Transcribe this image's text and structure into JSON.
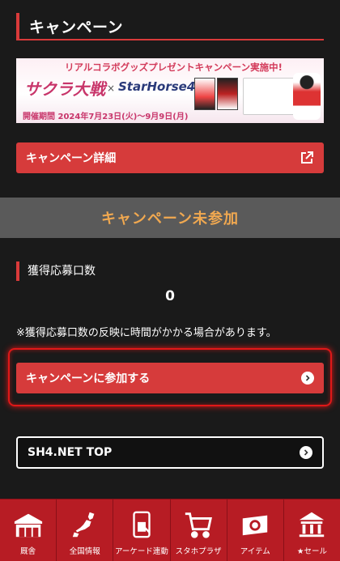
{
  "campaign": {
    "section_title": "キャンペーン",
    "banner": {
      "headline": "リアルコラボグッズプレゼントキャンペーン実施中!",
      "logo_left": "サクラ大戦",
      "times": "×",
      "logo_right": "StarHorse4",
      "period": "開催期間 2024年7月23日(火)〜9月9日(月)"
    },
    "details_button": "キャンペーン詳細",
    "status": "キャンペーン未参加",
    "entries_label": "獲得応募口数",
    "entries_count": "0",
    "note": "※獲得応募口数の反映に時間がかかる場合があります。",
    "join_button": "キャンペーンに参加する",
    "top_button": "SH4.NET TOP"
  },
  "bottom_nav": {
    "items": [
      {
        "label": "厩舎",
        "icon": "stable-icon"
      },
      {
        "label": "全国情報",
        "icon": "japan-map-icon"
      },
      {
        "label": "アーケード連動",
        "icon": "arcade-link-icon"
      },
      {
        "label": "スタホプラザ",
        "icon": "cart-icon"
      },
      {
        "label": "アイテム",
        "icon": "item-ticket-icon"
      },
      {
        "label": "★セール",
        "icon": "shop-icon"
      }
    ]
  },
  "colors": {
    "accent_red": "#d63b3b",
    "status_orange": "#f0a850",
    "nav_red": "#b71c24"
  }
}
